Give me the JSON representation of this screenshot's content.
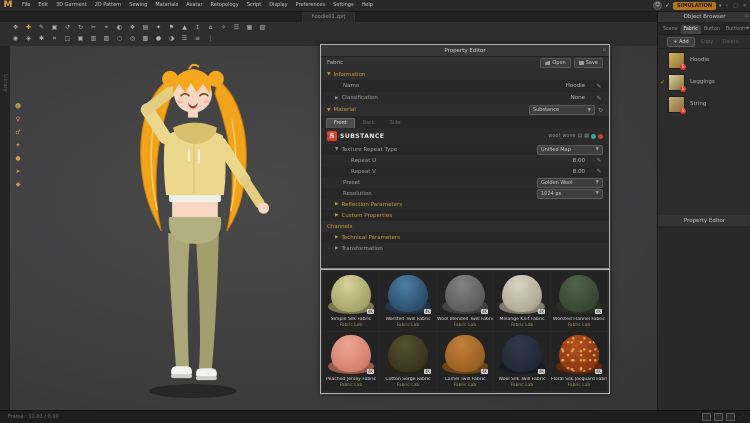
{
  "menu_bar": {
    "logo": "M",
    "items": [
      "File",
      "Edit",
      "3D Garment",
      "2D Pattern",
      "Sewing",
      "Materials",
      "Avatar",
      "Retopology",
      "Script",
      "Display",
      "Preferences",
      "Settings",
      "Help"
    ],
    "simulation_button": "SIMULATION"
  },
  "title_tab": "hoodie01.zprj",
  "left_strip_label": "Library",
  "toolbars": {
    "row1": [
      [
        "select-tool",
        "✥"
      ],
      [
        "move-tool",
        "✚",
        "g"
      ],
      [
        "pen-tool",
        "✎"
      ],
      [
        "rectangle-tool",
        "▣"
      ],
      [
        "undo",
        "↺"
      ],
      [
        "redo",
        "↻"
      ],
      [
        "scissors-tool",
        "✂"
      ],
      [
        "pin-tool",
        "⌖"
      ],
      [
        "sphere-tool",
        "◐"
      ],
      [
        "gizmo-tool",
        "❖"
      ],
      [
        "layers-tool",
        "▤"
      ],
      [
        "sparkle-tool",
        "✦"
      ],
      [
        "flag-tool",
        "⚑"
      ],
      [
        "avatar-tool",
        "▲"
      ],
      [
        "raise-tool",
        "↥"
      ],
      [
        "home-view",
        "⌂"
      ],
      [
        "star-tool",
        "✧"
      ],
      [
        "list-tool",
        "☰"
      ],
      [
        "grid-tool",
        "▦"
      ],
      [
        "hatch-tool",
        "▧"
      ]
    ],
    "row2": [
      [
        "circle-tool",
        "◉"
      ],
      [
        "gem-tool",
        "◈"
      ],
      [
        "asterisk-tool",
        "✱"
      ],
      [
        "hash-tool",
        "⌗"
      ],
      [
        "square-tool",
        "□"
      ],
      [
        "filled-square-tool",
        "▣"
      ],
      [
        "stripes-tool",
        "▥"
      ],
      [
        "crosshatch-tool",
        "▨"
      ],
      [
        "ring-tool",
        "○"
      ],
      [
        "bullseye-tool",
        "◎"
      ],
      [
        "dense-grid-tool",
        "▩"
      ],
      [
        "dot-tool",
        "●"
      ],
      [
        "half-tool",
        "◑"
      ],
      [
        "bars-tool",
        "☰"
      ],
      [
        "equals-tool",
        "≡"
      ],
      [
        "more-tools",
        "⋮"
      ]
    ],
    "left": [
      [
        "show-avatar-tool",
        "☻"
      ],
      [
        "female-avatar-tool",
        "♀"
      ],
      [
        "male-avatar-tool",
        "♂"
      ],
      [
        "sparkle-avatar-tool",
        "✦"
      ],
      [
        "dot-tool",
        "●"
      ],
      [
        "pointer-tool",
        "➤"
      ],
      [
        "diamond-tool",
        "◆"
      ]
    ]
  },
  "property_editor": {
    "title": "Property Editor",
    "fabric": {
      "label": "Fabric",
      "open": "Open",
      "save": "Save"
    },
    "information": {
      "header": "Information",
      "name_label": "Name",
      "name_value": "Hoodie",
      "classification_label": "Classification",
      "classification_value": "None"
    },
    "material": {
      "header": "Material",
      "type_value": "Substance",
      "tabs": [
        "Front",
        "Back",
        "Side"
      ],
      "substance": {
        "brand": "SUBSTANCE",
        "file": "wool_wove"
      },
      "texture_repeat": {
        "label": "Texture Repeat Type",
        "value": "Unified Map"
      },
      "repeat_u": {
        "label": "Repeat U",
        "value": "8.00"
      },
      "repeat_v": {
        "label": "Repeat V",
        "value": "8.00"
      },
      "preset": {
        "label": "Preset",
        "value": "Golden Wool"
      },
      "resolution": {
        "label": "Resolution",
        "value": "1024 px"
      },
      "collapsed": [
        "Reflection Parameters",
        "Custom Properties"
      ]
    },
    "channels": {
      "header": "Channels",
      "collapsed": [
        "Technical Parameters",
        "Transformation"
      ]
    }
  },
  "swatch_panel": {
    "items": [
      {
        "name": "Simple Silk Fabric",
        "sub": "Fabric Lab",
        "badge": "4K",
        "main": "#d6d49a",
        "shade": "#a8a66e",
        "dark": "#8d8b55"
      },
      {
        "name": "Worsted Twill Fabric",
        "sub": "Fabric Lab",
        "badge": "4K",
        "main": "#4e7fa6",
        "shade": "#2d4f6e",
        "dark": "#24405a"
      },
      {
        "name": "Wool Blended Twill Fabric",
        "sub": "Fabric Lab",
        "badge": "4K",
        "main": "#828282",
        "shade": "#5e5e5e",
        "dark": "#4a4a4a"
      },
      {
        "name": "Melange Knit Fabric",
        "sub": "Fabric Lab",
        "badge": "4K",
        "main": "#d9d3c4",
        "shade": "#b3ac99",
        "dark": "#938c7a"
      },
      {
        "name": "Worsted Flannel Fabric",
        "sub": "Fabric Lab",
        "badge": "4K",
        "main": "#50634c",
        "shade": "#394832",
        "dark": "#2c3827"
      },
      {
        "name": "Peached Jersey Fabric",
        "sub": "Fabric Lab",
        "badge": "4K",
        "main": "#efa694",
        "shade": "#d58270",
        "dark": "#b5654f"
      },
      {
        "name": "Cotton Serge Fabric",
        "sub": "Fabric Lab",
        "badge": "4K",
        "main": "#55502f",
        "shade": "#3a371f",
        "dark": "#2b2917"
      },
      {
        "name": "Camel Twill Fabric",
        "sub": "Fabric Lab",
        "badge": "4K",
        "main": "#c28038",
        "shade": "#9c6124",
        "dark": "#7c4c1a"
      },
      {
        "name": "Wool Silk Twill Fabric",
        "sub": "Fabric Lab",
        "badge": "4K",
        "main": "#333a4e",
        "shade": "#232837",
        "dark": "#181c28"
      },
      {
        "name": "Floral Silk Jacquard Fabric",
        "sub": "Fabric Lab",
        "badge": "4K",
        "main": "#b84e1e",
        "shade": "#8c3812",
        "dark": "#6e2b0c",
        "pattern": true
      }
    ]
  },
  "object_browser": {
    "title": "Object Browser",
    "tabs": [
      "Scene",
      "Fabric",
      "Button",
      "Buttonhole"
    ],
    "active_tab": "Fabric",
    "buttons": {
      "add": "+ Add",
      "copy": "Copy",
      "delete": "Delete"
    },
    "items": [
      {
        "name": "Hoodie",
        "checked": false,
        "color": "#d9b25c"
      },
      {
        "name": "Leggings",
        "checked": true,
        "color": "#d3d3a0"
      },
      {
        "name": "String",
        "checked": false,
        "color": "#c8b07a"
      }
    ],
    "lower_title": "Property Editor"
  },
  "status_bar": {
    "left": "Frame : 12.01 / 0.00"
  },
  "colors": {
    "accent": "#d79b2e",
    "section_text": "#cf9a3a",
    "substance_red": "#e03c31",
    "simulation_button": "#b5741c"
  }
}
